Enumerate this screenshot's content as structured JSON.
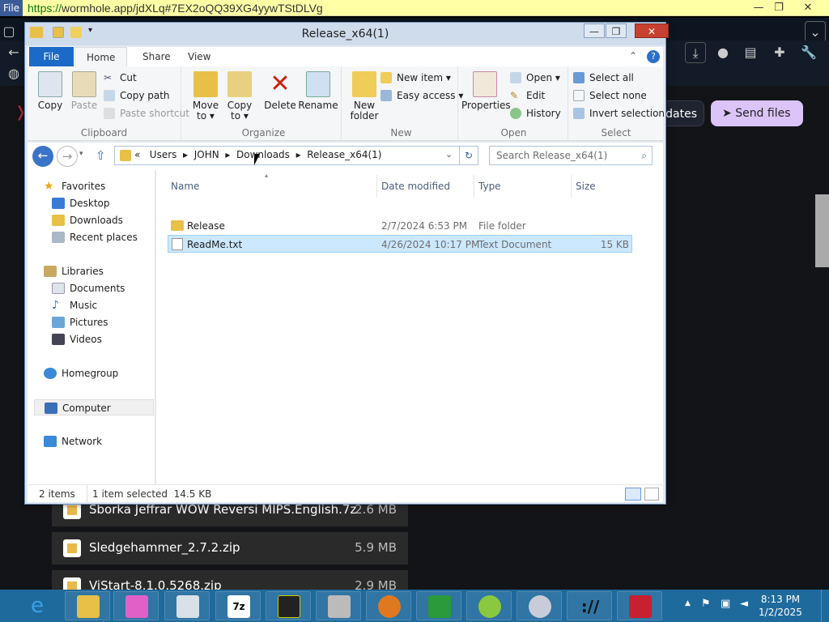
{
  "browser": {
    "file_menu": "File",
    "url_scheme": "https://",
    "url_rest": "wormhole.app/jdXLq#7EX2oQQ39XG4yywTStDLVg"
  },
  "page": {
    "updates_label": "dates",
    "send_files_label": "Send files",
    "files": [
      {
        "name": "Sborka Jeffrar WOW Reversi MIPS.English.7z",
        "size": "2.6 MB"
      },
      {
        "name": "Sledgehammer_2.7.2.zip",
        "size": "5.9 MB"
      },
      {
        "name": "ViStart-8.1.0.5268.zip",
        "size": "2.9 MB"
      }
    ]
  },
  "explorer": {
    "title": "Release_x64(1)",
    "ribbon_tabs": [
      "File",
      "Home",
      "Share",
      "View"
    ],
    "clipboard": {
      "copy": "Copy",
      "paste": "Paste",
      "cut": "Cut",
      "copy_path": "Copy path",
      "paste_shortcut": "Paste shortcut",
      "label": "Clipboard"
    },
    "organize": {
      "move_to": "Move to ▾",
      "copy_to": "Copy to ▾",
      "delete": "Delete",
      "rename": "Rename",
      "label": "Organize",
      "move_top": "Move",
      "move_bot": "to ▾",
      "copy_top": "Copy",
      "copy_bot": "to ▾"
    },
    "new": {
      "new_folder_top": "New",
      "new_folder_bot": "folder",
      "new_item": "New item ▾",
      "easy_access": "Easy access ▾",
      "label": "New"
    },
    "open": {
      "properties": "Properties",
      "open": "Open ▾",
      "edit": "Edit",
      "history": "History",
      "label": "Open"
    },
    "select": {
      "select_all": "Select all",
      "select_none": "Select none",
      "invert": "Invert selection",
      "label": "Select"
    },
    "breadcrumb": [
      "«",
      "Users",
      "▸",
      "JOHN",
      "▸",
      "Downloads",
      "▸",
      "Release_x64(1)"
    ],
    "search_placeholder": "Search Release_x64(1)",
    "nav": {
      "favorites": "Favorites",
      "desktop": "Desktop",
      "downloads": "Downloads",
      "recent": "Recent places",
      "libraries": "Libraries",
      "documents": "Documents",
      "music": "Music",
      "pictures": "Pictures",
      "videos": "Videos",
      "homegroup": "Homegroup",
      "computer": "Computer",
      "network": "Network"
    },
    "columns": {
      "name": "Name",
      "date": "Date modified",
      "type": "Type",
      "size": "Size"
    },
    "rows": [
      {
        "name": "Release",
        "date": "2/7/2024 6:53 PM",
        "type": "File folder",
        "size": ""
      },
      {
        "name": "ReadMe.txt",
        "date": "4/26/2024 10:17 PM",
        "type": "Text Document",
        "size": "15 KB"
      }
    ],
    "status": {
      "items": "2 items",
      "selected": "1 item selected",
      "size": "14.5 KB"
    }
  },
  "taskbar": {
    "time": "8:13 PM",
    "date": "1/2/2025"
  }
}
